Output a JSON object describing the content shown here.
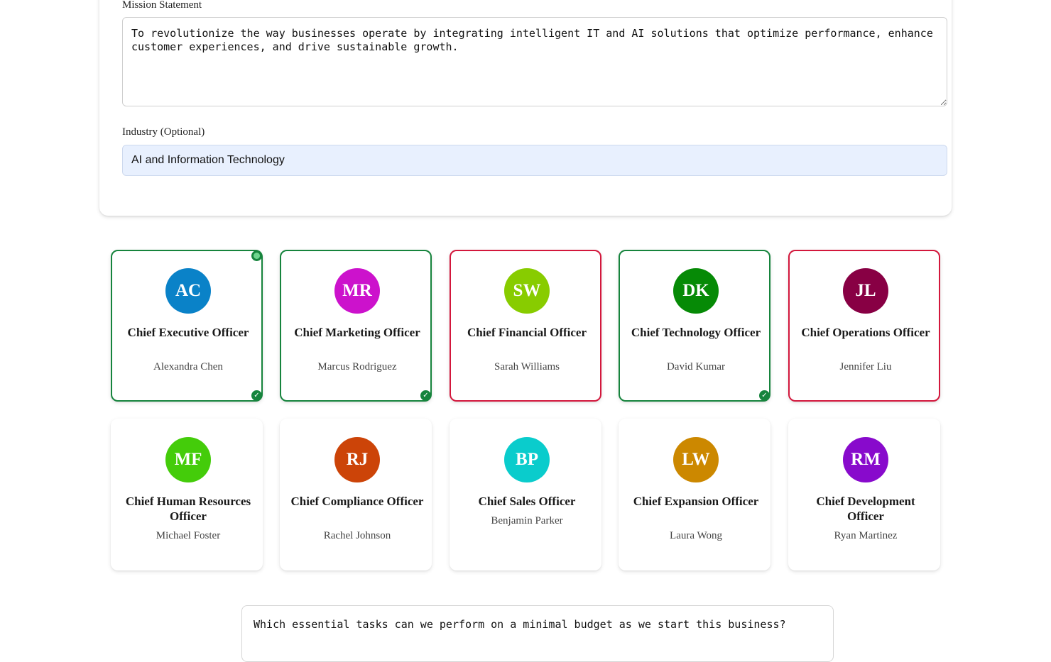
{
  "form": {
    "mission_label": "Mission Statement",
    "mission_value": "To revolutionize the way businesses operate by integrating intelligent IT and AI solutions that optimize performance, enhance customer experiences, and drive sustainable growth.",
    "industry_label": "Industry (Optional)",
    "industry_value": "AI and Information Technology"
  },
  "colors": {
    "selected_border": "#16843d",
    "rejected_border": "#d3173c",
    "autofill_bg": "#e8f0fe"
  },
  "executives": [
    {
      "initials": "AC",
      "role": "Chief Executive Officer",
      "name": "Alexandra Chen",
      "color": "#0a82c8",
      "state": "selected"
    },
    {
      "initials": "MR",
      "role": "Chief Marketing Officer",
      "name": "Marcus Rodriguez",
      "color": "#cc12cc",
      "state": "selected"
    },
    {
      "initials": "SW",
      "role": "Chief Financial Officer",
      "name": "Sarah Williams",
      "color": "#88cc00",
      "state": "rejected"
    },
    {
      "initials": "DK",
      "role": "Chief Technology Officer",
      "name": "David Kumar",
      "color": "#068a06",
      "state": "selected"
    },
    {
      "initials": "JL",
      "role": "Chief Operations Officer",
      "name": "Jennifer Liu",
      "color": "#880044",
      "state": "rejected"
    },
    {
      "initials": "MF",
      "role": "Chief Human Resources Officer",
      "name": "Michael Foster",
      "color": "#44cc0a",
      "state": "none"
    },
    {
      "initials": "RJ",
      "role": "Chief Compliance Officer",
      "name": "Rachel Johnson",
      "color": "#cc4408",
      "state": "none"
    },
    {
      "initials": "BP",
      "role": "Chief Sales Officer",
      "name": "Benjamin Parker",
      "color": "#0acccc",
      "state": "none"
    },
    {
      "initials": "LW",
      "role": "Chief Expansion Officer",
      "name": "Laura Wong",
      "color": "#cc8800",
      "state": "none"
    },
    {
      "initials": "RM",
      "role": "Chief Development Officer",
      "name": "Ryan Martinez",
      "color": "#880acc",
      "state": "none"
    }
  ],
  "question": {
    "value": "Which essential tasks can we perform on a minimal budget as we start this business?"
  }
}
